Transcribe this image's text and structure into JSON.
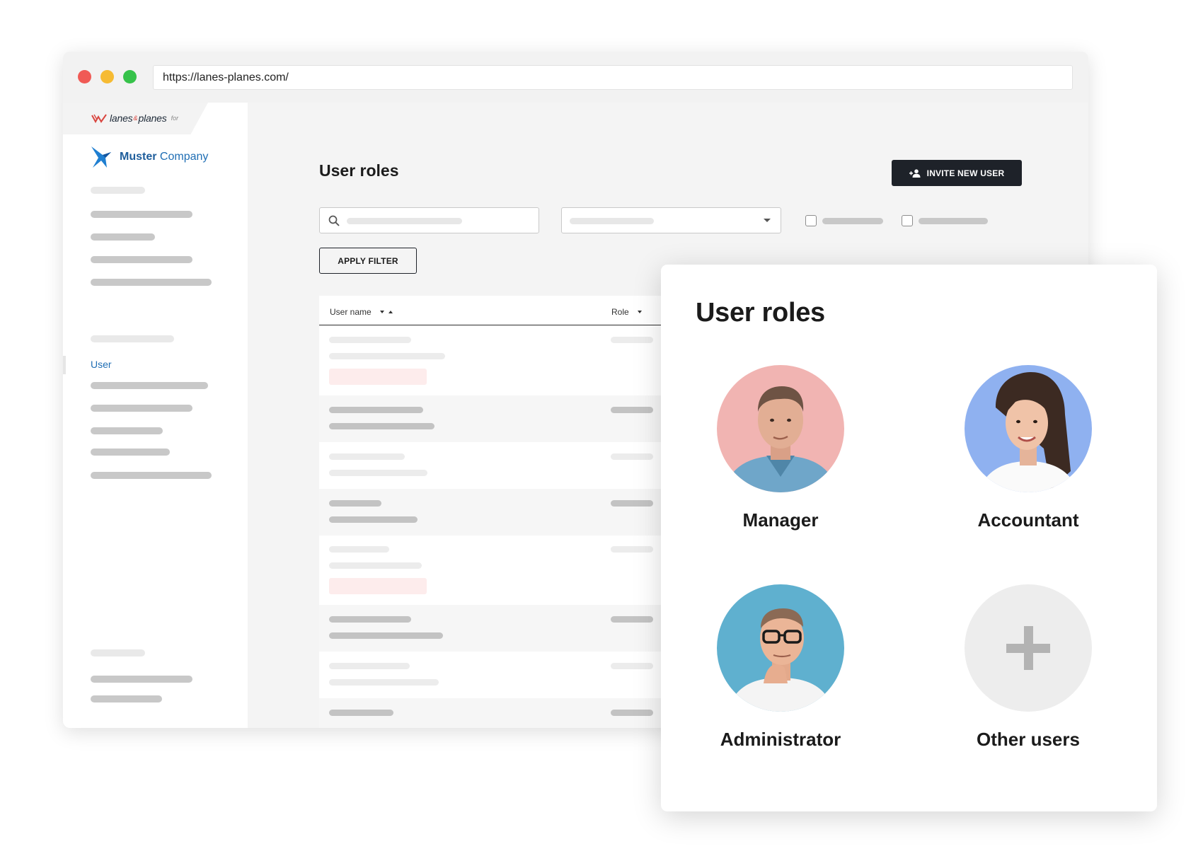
{
  "browser": {
    "url": "https://lanes-planes.com/"
  },
  "brand": {
    "name_part1": "lanes",
    "name_amp": "&",
    "name_part2": "planes",
    "for_label": "for",
    "company_bold": "Muster",
    "company_rest": "Company"
  },
  "sidebar": {
    "active_item": "User"
  },
  "page": {
    "title": "User roles",
    "invite_button": "INVITE NEW USER",
    "apply_filter_button": "APPLY FILTER"
  },
  "table": {
    "columns": [
      "User name",
      "Role"
    ]
  },
  "roles_card": {
    "title": "User roles",
    "roles": [
      {
        "name": "Manager",
        "avatar_bg": "#f1b4b2"
      },
      {
        "name": "Accountant",
        "avatar_bg": "#8fb1f0"
      },
      {
        "name": "Administrator",
        "avatar_bg": "#5fb0cf"
      },
      {
        "name": "Other users",
        "avatar_bg": "#ededed"
      }
    ]
  },
  "colors": {
    "accent_blue": "#1f6eb4",
    "dark_button": "#1e2229",
    "brand_red": "#d9453f"
  }
}
